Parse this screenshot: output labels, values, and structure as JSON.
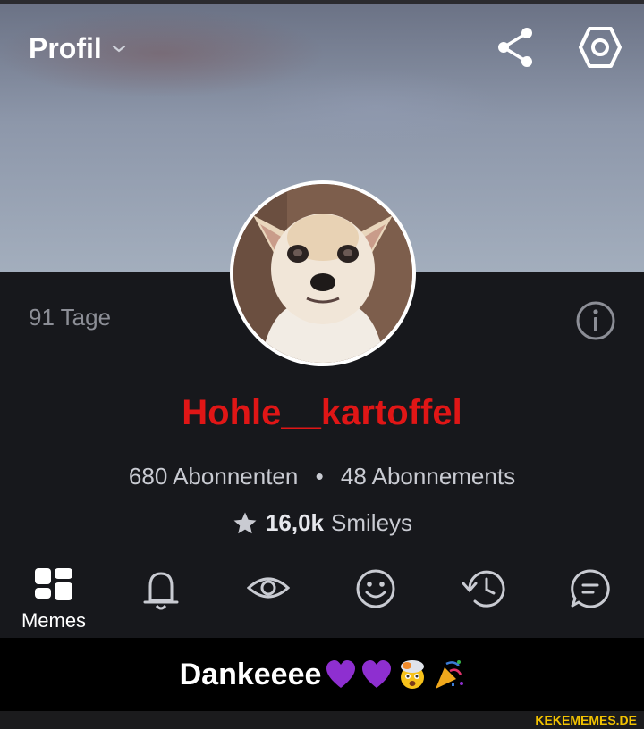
{
  "header": {
    "title": "Profil"
  },
  "profile": {
    "days": "91 Tage",
    "username": "Hohle__kartoffel",
    "followers": "680 Abonnenten",
    "separator": "•",
    "following": "48 Abonnements",
    "smileys_count": "16,0k",
    "smileys_label": "Smileys"
  },
  "tabs": [
    {
      "label": "Memes",
      "icon": "grid-icon",
      "active": true
    },
    {
      "label": "",
      "icon": "bell-icon"
    },
    {
      "label": "",
      "icon": "eye-icon"
    },
    {
      "label": "",
      "icon": "smiley-icon"
    },
    {
      "label": "",
      "icon": "history-icon"
    },
    {
      "label": "",
      "icon": "comment-icon"
    }
  ],
  "caption": {
    "text": "Dankeeee",
    "emojis": [
      "purple-heart",
      "purple-heart",
      "exploding-head",
      "party-popper"
    ]
  },
  "watermark": "KEKEMEMES.DE",
  "colors": {
    "username": "#e01616",
    "background": "#17181c",
    "watermark": "#f2c200"
  }
}
